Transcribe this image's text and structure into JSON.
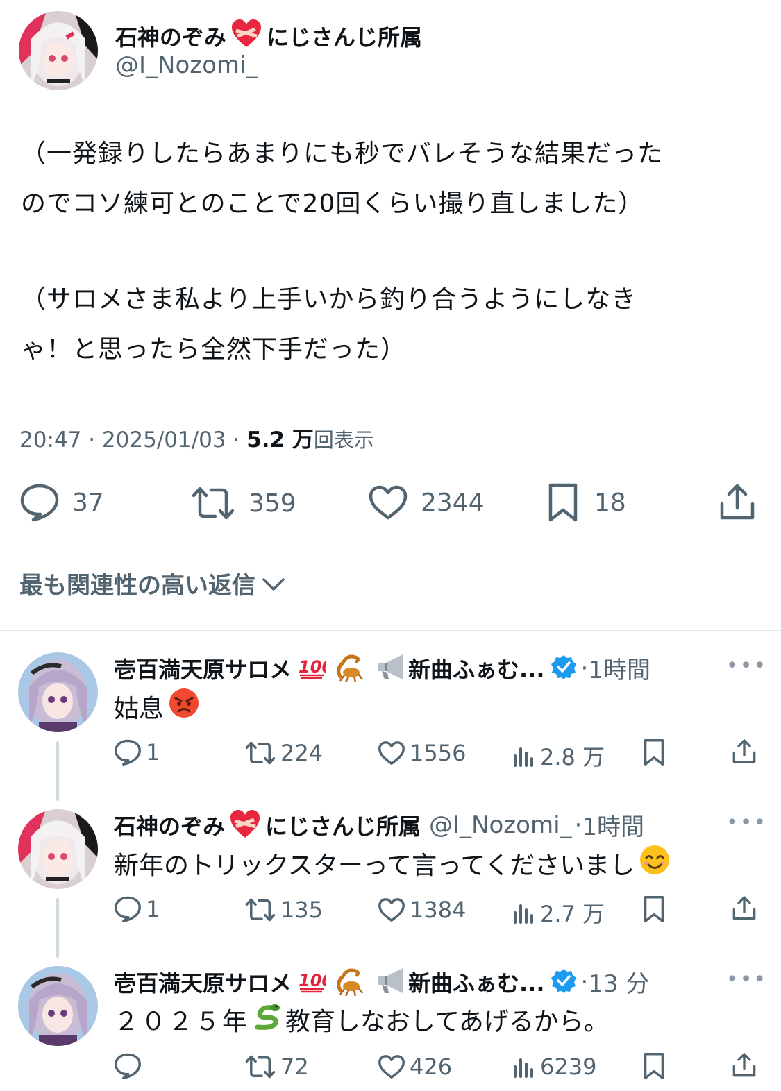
{
  "main_tweet": {
    "display_name": "石神のぞみ",
    "name_suffix": "にじさんじ所属",
    "name_emoji": "mending-heart",
    "handle": "@I_Nozomi_",
    "paragraph_1_line_1": "（一発録りしたらあまりにも秒でバレそうな結果だった",
    "paragraph_1_line_2": "のでコソ練可とのことで20回くらい撮り直しました）",
    "paragraph_2_line_1": "（サロメさま私より上手いから釣り合うようにしなき",
    "paragraph_2_line_2": "ゃ！と思ったら全然下手だった）",
    "time": "20:47",
    "date": "2025/01/03",
    "views_value": "5.2 万",
    "views_label": "回表示",
    "separator": "·",
    "replies": "37",
    "retweets": "359",
    "likes": "2344",
    "bookmarks": "18"
  },
  "relevant_replies_label": "最も関連性の高い返信",
  "replies": [
    {
      "display_name": "壱百満天原サロメ",
      "name_extra": "新曲ふぁむ...",
      "time": "1時間",
      "text": "姑息",
      "text_emoji": "angry-face",
      "replies": "1",
      "retweets": "224",
      "likes": "1556",
      "views": "2.8 万"
    },
    {
      "display_name": "石神のぞみ",
      "name_suffix": "にじさんじ所属",
      "handle": "@I_Nozomi_",
      "time": "1時間",
      "text": "新年のトリックスターって言ってくださいまし",
      "text_emoji": "smiling-face",
      "replies": "1",
      "retweets": "135",
      "likes": "1384",
      "views": "2.7 万"
    },
    {
      "display_name": "壱百満天原サロメ",
      "name_extra": "新曲ふぁむ...",
      "time": "13 分",
      "text_part_1": "２０２５年",
      "text_part_2": "教育しなおしてあげるから。",
      "text_emoji": "snake",
      "replies": "",
      "retweets": "72",
      "likes": "426",
      "views": "6239"
    }
  ],
  "colors": {
    "text": "#0f1419",
    "secondary": "#536471",
    "verified": "#1d9bf0",
    "divider": "#e1e8ed"
  },
  "icons": [
    "reply-icon",
    "retweet-icon",
    "like-icon",
    "bookmark-icon",
    "share-icon",
    "views-icon",
    "more-icon",
    "verified-icon",
    "chevron-down-icon"
  ]
}
